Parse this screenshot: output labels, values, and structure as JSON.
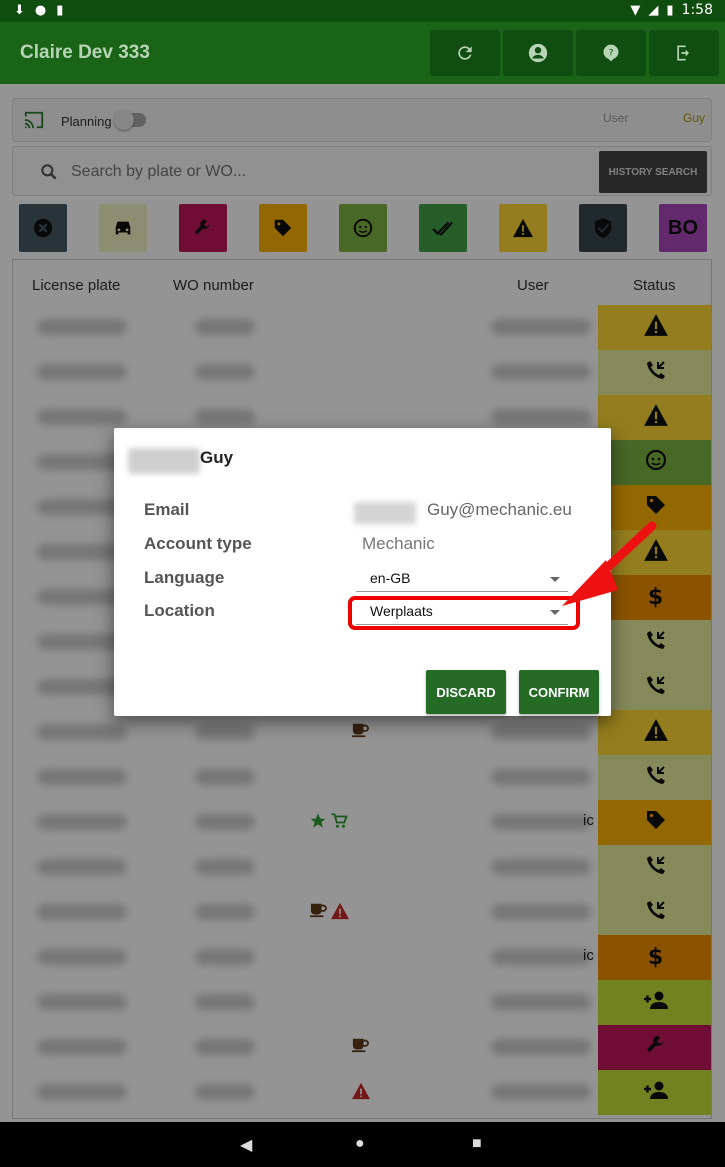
{
  "status_bar": {
    "time": "1:58",
    "icons": [
      "download-icon",
      "circle-icon",
      "sd-card-icon",
      "wifi-icon",
      "signal-icon",
      "battery-icon"
    ]
  },
  "app": {
    "title": "Claire Dev 333",
    "actions": [
      {
        "name": "refresh-button",
        "icon": "refresh-icon"
      },
      {
        "name": "account-button",
        "icon": "account-icon"
      },
      {
        "name": "help-button",
        "icon": "help-icon"
      },
      {
        "name": "logout-button",
        "icon": "logout-icon"
      }
    ],
    "color_primary": "#1a6418"
  },
  "planning": {
    "label": "Planning",
    "toggle_on": false,
    "user_label": "User",
    "user_name": "Guy"
  },
  "search": {
    "placeholder": "Search by plate or WO...",
    "button_label": "HISTORY SEARCH"
  },
  "filters": [
    {
      "icon": "cancel-icon",
      "color": "#455a64"
    },
    {
      "icon": "car-icon",
      "color": "#f0f4c3"
    },
    {
      "icon": "wrench-icon",
      "color": "#c2185b"
    },
    {
      "icon": "tag-icon",
      "color": "#ffb300"
    },
    {
      "icon": "face-icon",
      "color": "#7cb342"
    },
    {
      "icon": "double-check-icon",
      "color": "#43a047"
    },
    {
      "icon": "warning-icon",
      "color": "#fdd835"
    },
    {
      "icon": "shield-icon",
      "color": "#37474f"
    },
    {
      "label": "BO",
      "color": "#ab47bc"
    }
  ],
  "table": {
    "headers": {
      "plate": "License plate",
      "wo": "WO number",
      "user": "User",
      "status": "Status"
    },
    "rows": [
      {
        "status": "warning-icon",
        "color": "#fdd835"
      },
      {
        "status": "phone-callback-icon",
        "color": "#e6ee9c"
      },
      {
        "status": "warning-icon",
        "color": "#fdd835"
      },
      {
        "status": "face-icon",
        "color": "#7cb342"
      },
      {
        "status": "tag-icon",
        "color": "#ffb300"
      },
      {
        "status": "warning-icon",
        "color": "#fdd835"
      },
      {
        "status": "dollar-icon",
        "color": "#ef8f00"
      },
      {
        "status": "phone-callback-icon",
        "color": "#e6ee9c"
      },
      {
        "status": "phone-callback-icon",
        "color": "#e6ee9c"
      },
      {
        "status": "warning-icon",
        "color": "#fdd835",
        "icons": [
          "coffee-icon"
        ]
      },
      {
        "status": "phone-callback-icon",
        "color": "#e6ee9c"
      },
      {
        "status": "tag-icon",
        "color": "#ffb300",
        "icons": [
          "star-icon",
          "cart-icon"
        ],
        "user": "ic"
      },
      {
        "status": "phone-callback-icon",
        "color": "#e6ee9c"
      },
      {
        "status": "phone-callback-icon",
        "color": "#e6ee9c",
        "icons": [
          "coffee-icon",
          "alert-icon"
        ]
      },
      {
        "status": "dollar-icon",
        "color": "#ef8f00",
        "user": "ic"
      },
      {
        "status": "person-add-icon",
        "color": "#c6e03a"
      },
      {
        "status": "wrench-icon",
        "color": "#c2185b",
        "icons": [
          "coffee-icon"
        ]
      },
      {
        "status": "person-add-icon",
        "color": "#c6e03a",
        "icons": [
          "alert-icon"
        ]
      }
    ]
  },
  "dialog": {
    "name": "Guy",
    "fields": {
      "email_label": "Email",
      "email_value": "Guy@mechanic.eu",
      "account_type_label": "Account type",
      "account_type_value": "Mechanic",
      "language_label": "Language",
      "language_value": "en-GB",
      "location_label": "Location",
      "location_value": "Werplaats"
    },
    "discard_label": "DISCARD",
    "confirm_label": "CONFIRM",
    "highlight_color": "#ee0000"
  },
  "nav": {
    "back": "back-icon",
    "home": "home-icon",
    "recents": "recents-icon"
  }
}
